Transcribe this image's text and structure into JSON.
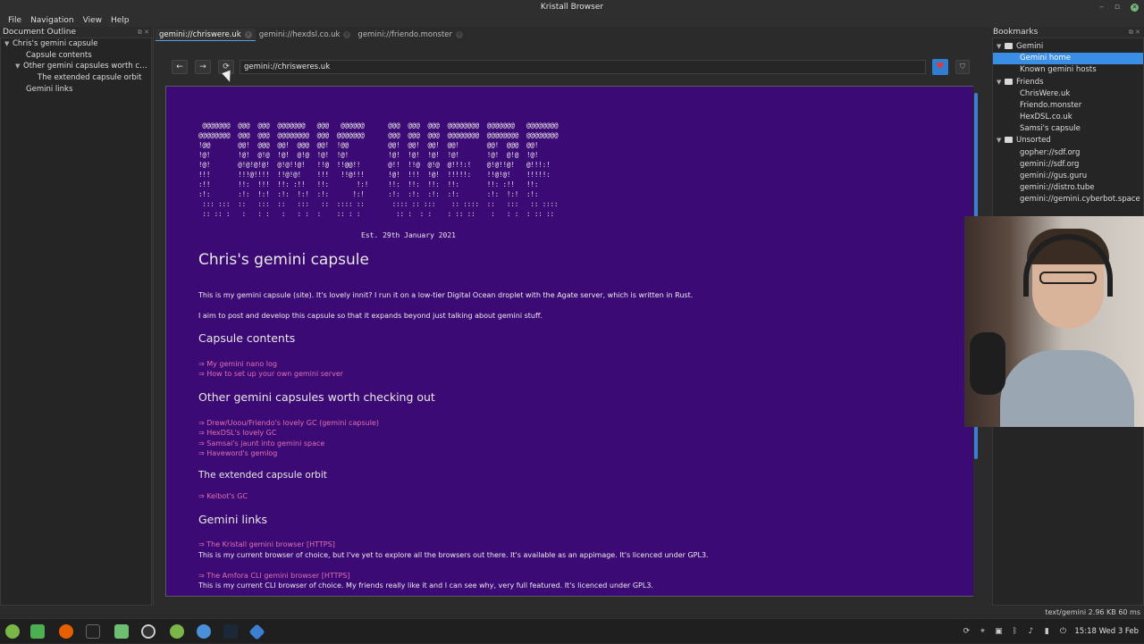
{
  "window": {
    "title": "Kristall Browser"
  },
  "menu": [
    "File",
    "Navigation",
    "View",
    "Help"
  ],
  "outline": {
    "title": "Document Outline",
    "items": [
      {
        "label": "Chris's gemini capsule",
        "level": 0,
        "expanded": true
      },
      {
        "label": "Capsule contents",
        "level": 1
      },
      {
        "label": "Other gemini capsules worth checking out",
        "level": 1,
        "expanded": true
      },
      {
        "label": "The extended capsule orbit",
        "level": 2
      },
      {
        "label": "Gemini links",
        "level": 1
      }
    ]
  },
  "tabs": [
    {
      "label": "gemini://chriswere.uk",
      "active": true
    },
    {
      "label": "gemini://hexdsl.co.uk",
      "active": false
    },
    {
      "label": "gemini://friendo.monster",
      "active": false
    }
  ],
  "nav": {
    "back_icon": "←",
    "forward_icon": "→",
    "reload_icon": "⟳",
    "url": "gemini://chrisweres.uk",
    "favorite_icon": "♥",
    "shield_icon": "⛉"
  },
  "page": {
    "ascii_art": " @@@@@@@  @@@  @@@  @@@@@@@   @@@   @@@@@@      @@@  @@@  @@@  @@@@@@@@  @@@@@@@   @@@@@@@@\n@@@@@@@@  @@@  @@@  @@@@@@@@  @@@  @@@@@@@      @@@  @@@  @@@  @@@@@@@@  @@@@@@@@  @@@@@@@@\n!@@       @@!  @@@  @@!  @@@  @@!  !@@          @@!  @@!  @@!  @@!       @@!  @@@  @@!\n!@!       !@!  @!@  !@!  @!@  !@!  !@!          !@!  !@!  !@!  !@!       !@!  @!@  !@!\n!@!       @!@!@!@!  @!@!!@!   !!@  !!@@!!       @!!  !!@  @!@  @!!!:!    @!@!!@!   @!!!:!\n!!!       !!!@!!!!  !!@!@!    !!!   !!@!!!      !@!  !!!  !@!  !!!!!:    !!@!@!    !!!!!:\n:!!       !!:  !!!  !!: :!!   !!:       !:!     !!:  !!:  !!:  !!:       !!: :!!   !!:\n:!:       :!:  !:!  :!:  !:!  :!:      !:!      :!:  :!:  :!:  :!:       :!:  !:!  :!:\n ::: :::  ::   :::  ::   :::   ::  :::: ::       :::: :: :::    :: ::::  ::   :::   :: ::::\n :: :: :   :   : :   :   : :  :    :: : :         :: :  : :    : :: ::    :   : :  : :: ::",
    "est": "Est. 29th January 2021",
    "title": "Chris's gemini capsule",
    "intro1": "This is my gemini capsule (site). It's lovely innit? I run it on a low-tier Digital Ocean droplet with the Agate server, which is written in Rust.",
    "intro2": "I aim to post and develop this capsule so that it expands beyond just talking about gemini stuff.",
    "h_contents": "Capsule contents",
    "contents_links": [
      "⇒ My gemini nano log",
      "⇒ How to set up your own gemini server"
    ],
    "h_other": "Other gemini capsules worth checking out",
    "other_links": [
      "⇒ Drew/Uoou/Friendo's lovely GC (gemini capsule)",
      "⇒ HexDSL's lovely GC",
      "⇒ Samsai's jaunt into gemini space",
      "⇒ Haveword's gemlog"
    ],
    "h_orbit": "The extended capsule orbit",
    "orbit_links": [
      "⇒ Kelbot's GC"
    ],
    "h_links": "Gemini links",
    "kristall_link": "⇒ The Kristall gemini browser [HTTPS]",
    "kristall_desc": "This is my current browser of choice, but I've yet to explore all the browsers out there. It's available as an appimage. It's licenced under GPL3.",
    "amfora_link": "⇒ The Amfora CLI gemini browser [HTTPS]",
    "amfora_desc": "This is my current CLI browser of choice. My friends really like it and I can see why, very full featured. It's licenced under GPL3."
  },
  "bookmarks": {
    "title": "Bookmarks",
    "items": [
      {
        "label": "Gemini",
        "folder": true,
        "level": 0
      },
      {
        "label": "Gemini home",
        "level": 1,
        "selected": true
      },
      {
        "label": "Known gemini hosts",
        "level": 1
      },
      {
        "label": "Friends",
        "folder": true,
        "level": 0
      },
      {
        "label": "ChrisWere.uk",
        "level": 1
      },
      {
        "label": "Friendo.monster",
        "level": 1
      },
      {
        "label": "HexDSL.co.uk",
        "level": 1
      },
      {
        "label": "Samsi's capsule",
        "level": 1
      },
      {
        "label": "Unsorted",
        "folder": true,
        "level": 0
      },
      {
        "label": "gopher://sdf.org",
        "level": 1
      },
      {
        "label": "gemini://sdf.org",
        "level": 1
      },
      {
        "label": "gemini://gus.guru",
        "level": 1
      },
      {
        "label": "gemini://distro.tube",
        "level": 1
      },
      {
        "label": "gemini://gemini.cyberbot.space",
        "level": 1
      }
    ]
  },
  "status": {
    "text": "text/gemini  2.96 KB  60 ms"
  },
  "taskbar": {
    "apps": [
      "mint-menu-icon",
      "files-icon",
      "firefox-icon",
      "terminal-icon",
      "folder-icon",
      "obs-icon",
      "gimp-icon",
      "chromium-icon",
      "steam-icon",
      "kristall-icon"
    ],
    "time": "15:18",
    "date": "Wed 3 Feb"
  },
  "colors": {
    "page_bg": "#3c0a74",
    "link": "#e36fb0",
    "accent": "#3a8ee6"
  }
}
